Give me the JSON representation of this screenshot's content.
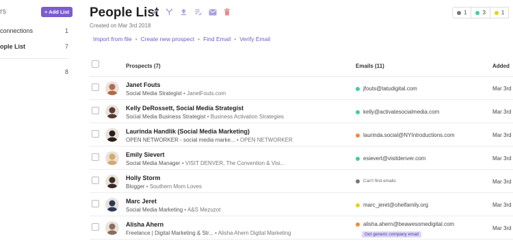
{
  "sidebar": {
    "title": "rs",
    "add_list_label": "+ Add List",
    "items": [
      {
        "label": "connections",
        "count": "1",
        "active": false
      },
      {
        "label": "ople List",
        "count": "7",
        "active": true
      },
      {
        "label": "",
        "count": "8",
        "active": false
      }
    ]
  },
  "header": {
    "title": "People List",
    "icons": [
      "pencil-icon",
      "filter-icon",
      "upload-icon",
      "list-check-icon",
      "mail-icon",
      "trash-icon"
    ],
    "created": "Created on Mar 3rd 2018",
    "actions": [
      "Import from file",
      "Create new prospect",
      "Find Email",
      "Verify Email"
    ],
    "badges": [
      {
        "color": "#777777",
        "count": "1"
      },
      {
        "color": "#3ecf9e",
        "count": "3"
      },
      {
        "color": "#e5d21a",
        "count": "1"
      }
    ]
  },
  "table": {
    "columns": {
      "prospects": "Prospects (7)",
      "emails": "Emails (11)",
      "added": "Added"
    },
    "rows": [
      {
        "name": "Janet Fouts",
        "title": "Social Media Strategist",
        "org": "JanetFouts.com",
        "email": "jfouts@tatudigital.com",
        "email_color": "#3ecf9e",
        "added": "Mar 3rd",
        "avatar_color": "#b36a4a"
      },
      {
        "name": "Kelly DeRossett, Social Media Strategist",
        "title": "Social Media Business Strategist",
        "org": "Business Activation Strategies",
        "email": "kelly@activatesocialmedia.com",
        "email_color": "#3ecf9e",
        "added": "Mar 3rd",
        "avatar_color": "#5a3b2e"
      },
      {
        "name": "Laurinda Handlik (Social Media Marketing)",
        "title": "OPEN NETWORKER - social media marke...",
        "org": "OPEN NETWORKER",
        "email": "laurinda.social@NYIntroductions.com",
        "email_color": "#f08a3c",
        "added": "Mar 3rd",
        "avatar_color": "#2b1d17"
      },
      {
        "name": "Emily Sievert",
        "title": "Social Media Manager",
        "org": "VISIT DENVER, The Convention & Visi...",
        "email": "esievert@visitdenver.com",
        "email_color": "#3ecf9e",
        "added": "Mar 3rd",
        "avatar_color": "#d9a76a"
      },
      {
        "name": "Holly Storm",
        "title": "Blogger",
        "org": "Southern Mom Loves",
        "email": "Can't find emails",
        "email_color": "#777777",
        "added": "Mar 3rd",
        "avatar_color": "#3a2a24"
      },
      {
        "name": "Marc Jeret",
        "title": "Social Media Marketing",
        "org": "A&S Mezuzot",
        "email": "marc_jeret@ohelfamily.org",
        "email_color": "#e5d21a",
        "added": "Mar 3rd",
        "avatar_color": "#2c3a52"
      },
      {
        "name": "Alisha Ahern",
        "title": "Freelance | Digital Marketing & Str...",
        "org": "Alisha Ahern Digital Marketing",
        "email": "alisha.ahern@beawesomedigital.com",
        "email_color": "#f08a3c",
        "added": "Mar 3rd",
        "avatar_color": "#8a6d5c",
        "tag": "Get generic company email"
      }
    ]
  }
}
